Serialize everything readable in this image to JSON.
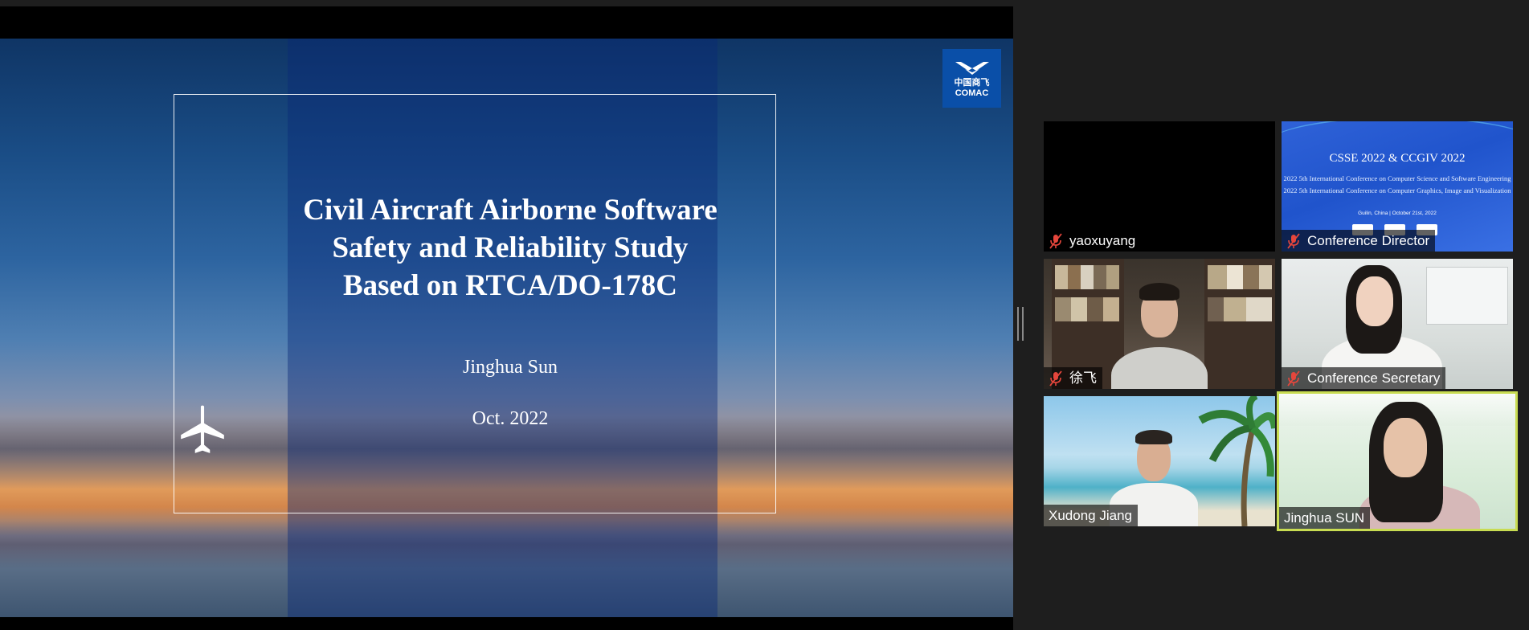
{
  "slide": {
    "title_lines": [
      "Civil Aircraft Airborne Software",
      "Safety and Reliability  Study",
      "Based on RTCA/DO-178C"
    ],
    "author": "Jinghua Sun",
    "date": "Oct. 2022",
    "logo_text_cn": "中国商飞",
    "logo_text_en": "COMAC"
  },
  "participants": [
    {
      "name": "yaoxuyang",
      "muted": true
    },
    {
      "name": "Conference Director",
      "muted": true
    },
    {
      "name": "徐飞",
      "muted": true
    },
    {
      "name": "Conference Secretary",
      "muted": true
    },
    {
      "name": "Xudong Jiang",
      "muted": false
    },
    {
      "name": "Jinghua SUN",
      "muted": false,
      "active_speaker": true
    }
  ],
  "conference_screen": {
    "title": "CSSE 2022 & CCGIV 2022",
    "line1": "2022 5th International Conference on Computer Science and Software Engineering",
    "line2": "2022 5th International Conference on Computer Graphics, Image and Visualization",
    "location_date": "Guilin, China | October 21st, 2022"
  },
  "colors": {
    "active_speaker_border": "#c8dc52",
    "mute_icon": "#e5463c",
    "logo_bg": "#0a4fa8"
  }
}
